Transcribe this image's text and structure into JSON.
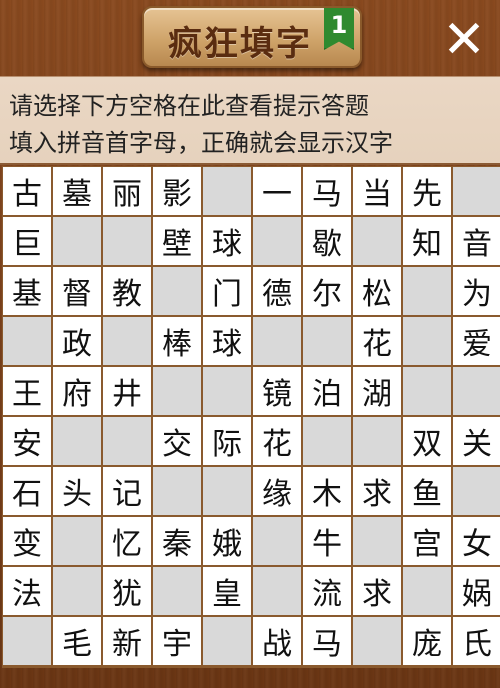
{
  "header": {
    "title": "疯狂填字",
    "level": "1",
    "close_label": "✕"
  },
  "hints": {
    "line1": "请选择下方空格在此查看提示答题",
    "line2": "填入拼音首字母，正确就会显示汉字"
  },
  "colors": {
    "wood": "#7a3f18",
    "hint_bg": "#e8d4bf",
    "cell_filled": "#ffffff",
    "cell_blank": "#d9d9d9",
    "badge_green": "#2f8a2f"
  },
  "grid": [
    [
      "古",
      "墓",
      "丽",
      "影",
      "",
      "一",
      "马",
      "当",
      "先",
      ""
    ],
    [
      "巨",
      "",
      "",
      "壁",
      "球",
      "",
      "歇",
      "",
      "知",
      "音"
    ],
    [
      "基",
      "督",
      "教",
      "",
      "门",
      "德",
      "尔",
      "松",
      "",
      "为"
    ],
    [
      "",
      "政",
      "",
      "棒",
      "球",
      "",
      "",
      "花",
      "",
      "爱"
    ],
    [
      "王",
      "府",
      "井",
      "",
      "",
      "镜",
      "泊",
      "湖",
      "",
      ""
    ],
    [
      "安",
      "",
      "",
      "交",
      "际",
      "花",
      "",
      "",
      "双",
      "关"
    ],
    [
      "石",
      "头",
      "记",
      "",
      "",
      "缘",
      "木",
      "求",
      "鱼",
      ""
    ],
    [
      "变",
      "",
      "忆",
      "秦",
      "娥",
      "",
      "牛",
      "",
      "宫",
      "女"
    ],
    [
      "法",
      "",
      "犹",
      "",
      "皇",
      "",
      "流",
      "求",
      "",
      "娲"
    ],
    [
      "",
      "毛",
      "新",
      "宇",
      "",
      "战",
      "马",
      "",
      "庞",
      "氏"
    ]
  ]
}
